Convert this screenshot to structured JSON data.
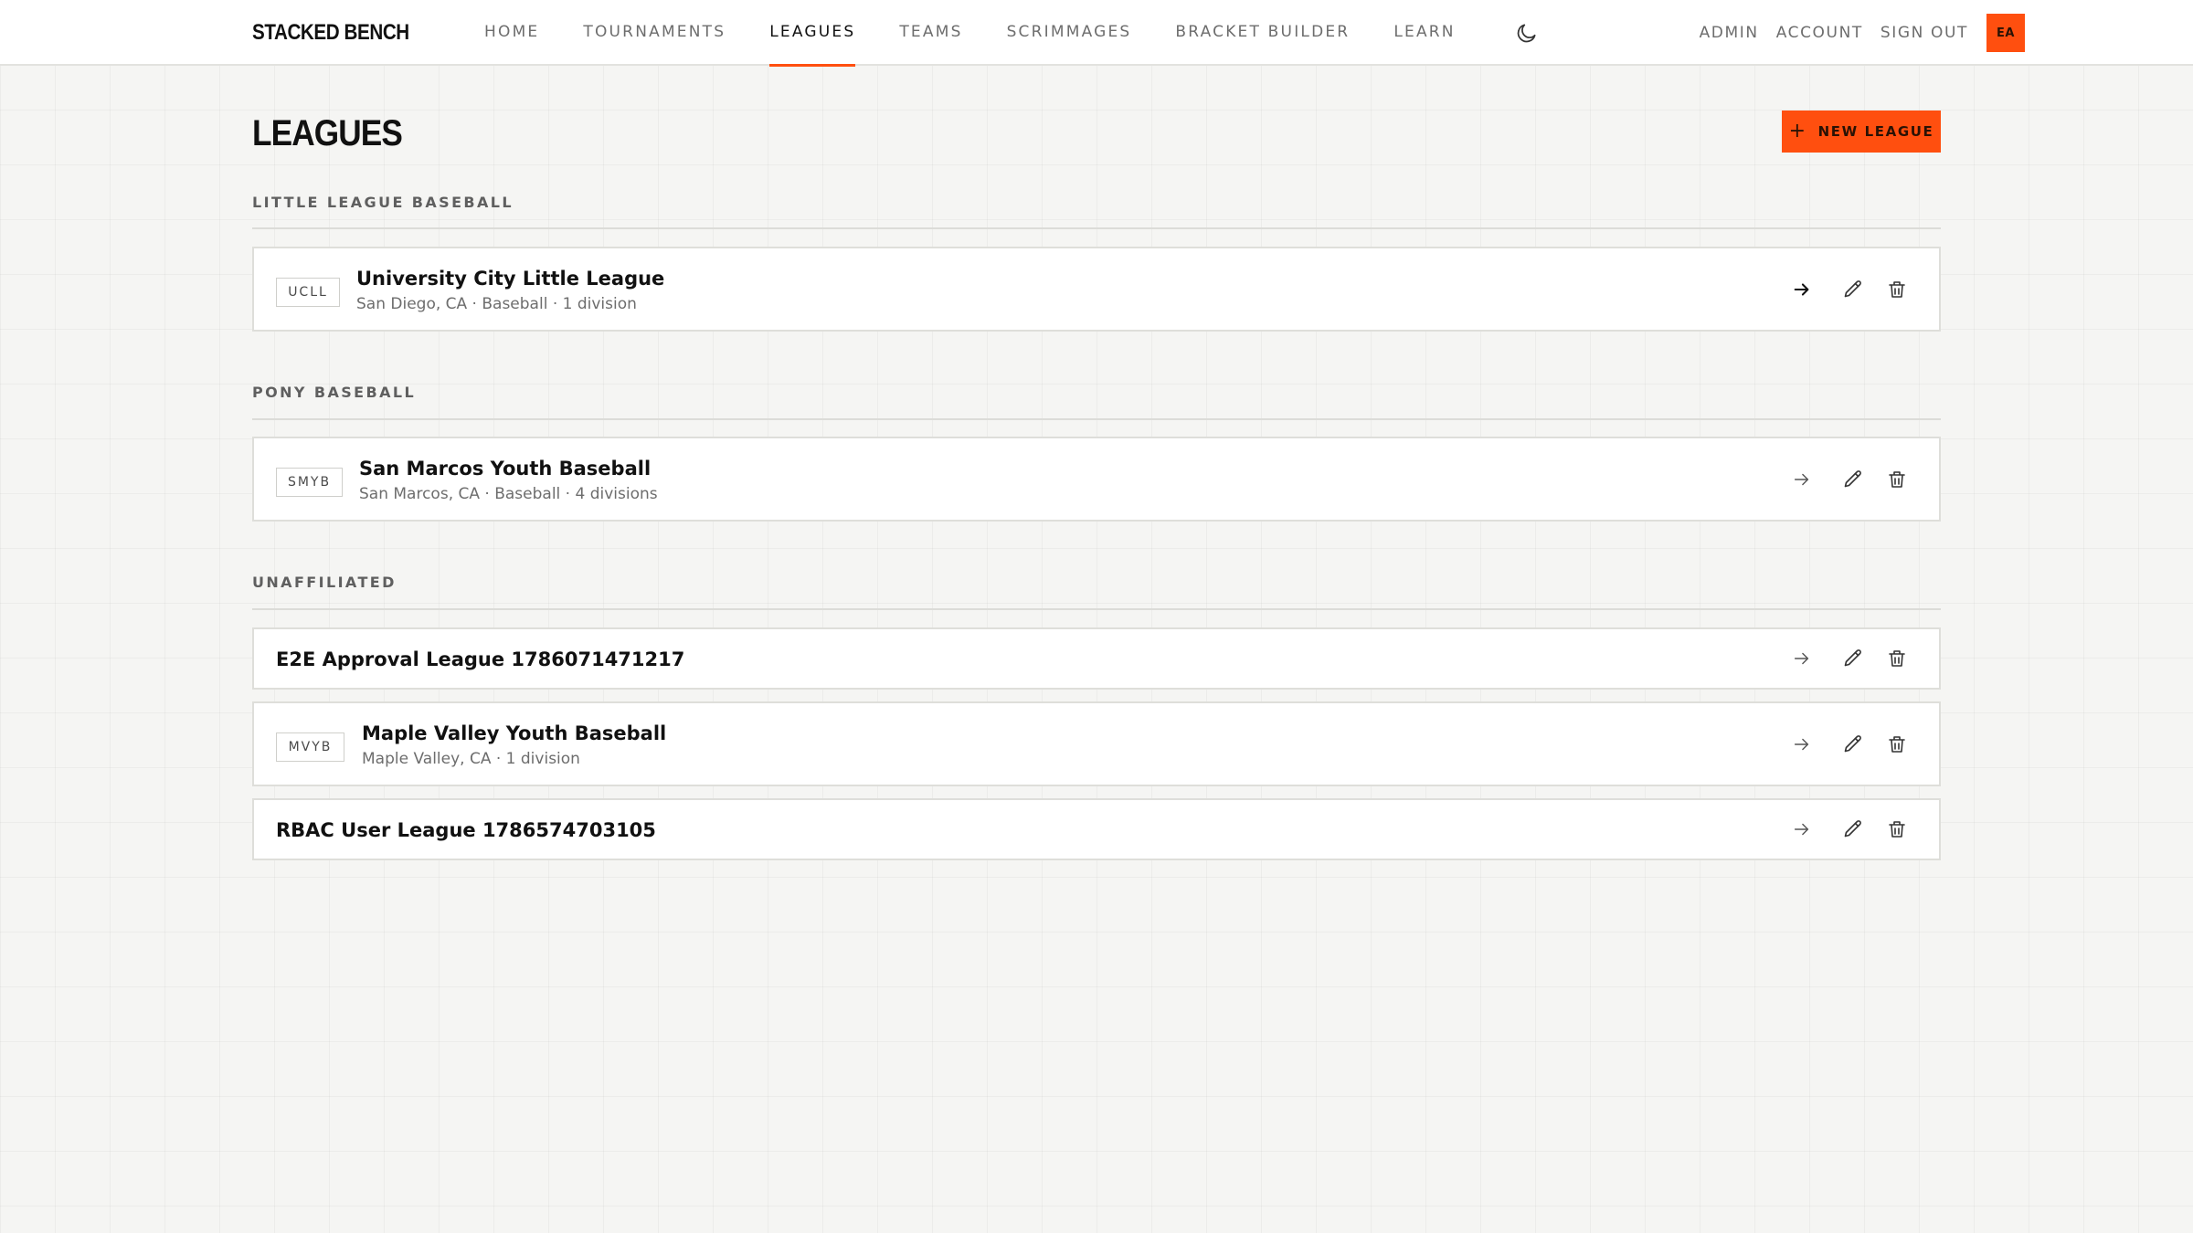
{
  "brand": "STACKED BENCH",
  "nav": {
    "links": [
      {
        "label": "HOME",
        "active": false
      },
      {
        "label": "TOURNAMENTS",
        "active": false
      },
      {
        "label": "LEAGUES",
        "active": true
      },
      {
        "label": "TEAMS",
        "active": false
      },
      {
        "label": "SCRIMMAGES",
        "active": false
      },
      {
        "label": "BRACKET BUILDER",
        "active": false
      },
      {
        "label": "LEARN",
        "active": false
      }
    ],
    "theme_icon": "moon-icon",
    "right": {
      "admin": "ADMIN",
      "account": "ACCOUNT",
      "sign_out": "SIGN OUT",
      "avatar_initials": "EA"
    }
  },
  "page": {
    "title": "LEAGUES",
    "new_button_label": "NEW LEAGUE",
    "new_button_icon": "+"
  },
  "colors": {
    "accent": "#ff4f0f",
    "background": "#f5f5f3"
  },
  "sections": [
    {
      "title": "LITTLE LEAGUE BASEBALL",
      "leagues": [
        {
          "abbr": "UCLL",
          "name": "University City Little League",
          "meta": "San Diego, CA · Baseball · 1 division"
        }
      ]
    },
    {
      "title": "PONY BASEBALL",
      "leagues": [
        {
          "abbr": "SMYB",
          "name": "San Marcos Youth Baseball",
          "meta": "San Marcos, CA · Baseball · 4 divisions"
        }
      ]
    },
    {
      "title": "UNAFFILIATED",
      "leagues": [
        {
          "abbr": "",
          "name": "E2E Approval League 1786071471217",
          "meta": ""
        },
        {
          "abbr": "MVYB",
          "name": "Maple Valley Youth Baseball",
          "meta": "Maple Valley, CA · 1 division"
        },
        {
          "abbr": "",
          "name": "RBAC User League 1786574703105",
          "meta": ""
        }
      ]
    }
  ],
  "row_actions": [
    "arrow-right-icon",
    "pencil-icon",
    "trash-icon"
  ]
}
